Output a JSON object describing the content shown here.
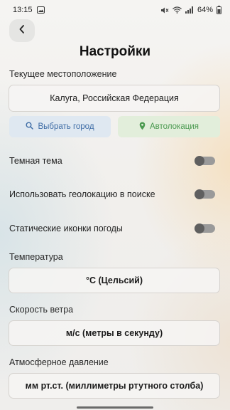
{
  "status_bar": {
    "time": "13:15",
    "battery": "64%"
  },
  "header": {
    "title": "Настройки"
  },
  "location": {
    "label": "Текущее местоположение",
    "value": "Калуга, Российская Федерация",
    "choose_city_button": "Выбрать город",
    "autolocation_button": "Автолокация"
  },
  "toggles": [
    {
      "label": "Темная тема",
      "on": false
    },
    {
      "label": "Использовать геолокацию в поиске",
      "on": false
    },
    {
      "label": "Статические иконки погоды",
      "on": false
    }
  ],
  "temperature": {
    "label": "Температура",
    "value": "°C (Цельсий)"
  },
  "wind": {
    "label": "Скорость ветра",
    "value": "м/с (метры в секунду)"
  },
  "pressure": {
    "label": "Атмосферное давление",
    "value": "мм рт.ст. (миллиметры ртутного столба)"
  },
  "colors": {
    "accent_blue": "#3f6da6",
    "accent_green": "#4b9a50"
  }
}
